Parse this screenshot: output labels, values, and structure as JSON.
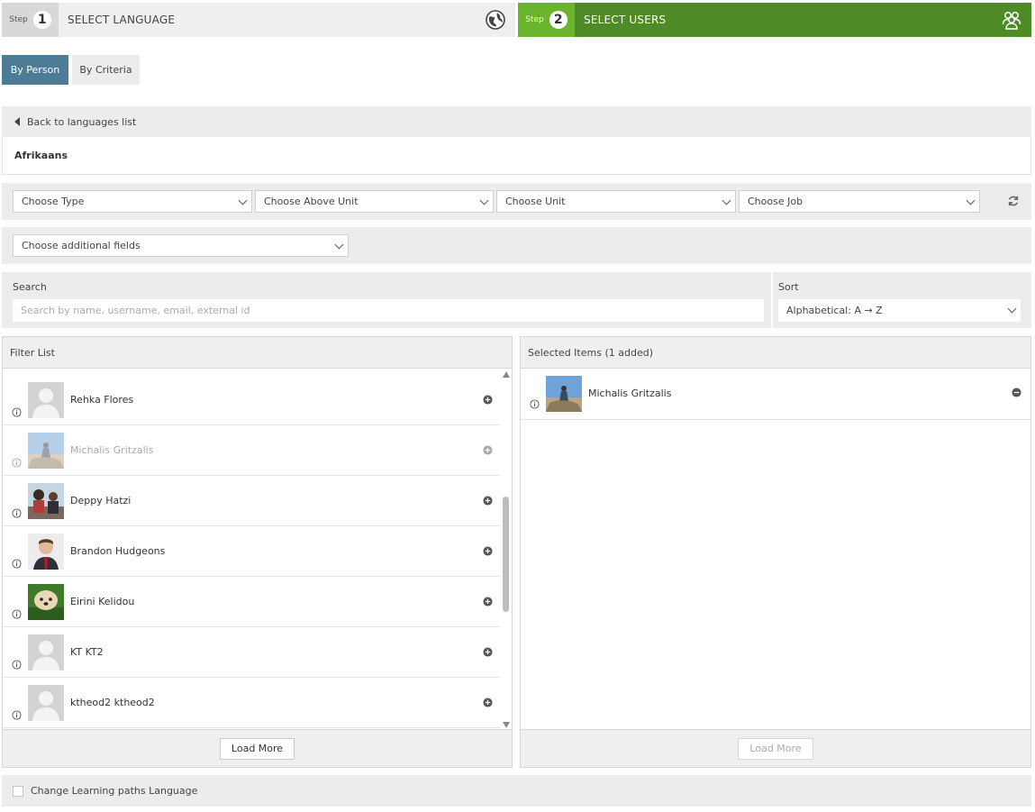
{
  "steps": [
    {
      "word": "Step",
      "number": "1",
      "title": "SELECT LANGUAGE",
      "icon": "globe-icon"
    },
    {
      "word": "Step",
      "number": "2",
      "title": "SELECT USERS",
      "icon": "users-icon"
    }
  ],
  "tabs": [
    {
      "label": "By Person",
      "active": true
    },
    {
      "label": "By Criteria",
      "active": false
    }
  ],
  "back_link": "Back to languages list",
  "language": "Afrikaans",
  "filters": {
    "type": "Choose Type",
    "above_unit": "Choose Above Unit",
    "unit": "Choose Unit",
    "job": "Choose Job",
    "additional": "Choose additional fields"
  },
  "search": {
    "label": "Search",
    "placeholder": "Search by name, username, email, external id"
  },
  "sort": {
    "label": "Sort",
    "value": "Alphabetical: A → Z"
  },
  "filter_list": {
    "title": "Filter List",
    "load_more": "Load More",
    "items": [
      {
        "name": "Rehka Flores",
        "avatar": "placeholder"
      },
      {
        "name": "Michalis Gritzalis",
        "avatar": "photo-sky",
        "disabled": true
      },
      {
        "name": "Deppy Hatzi",
        "avatar": "photo-people"
      },
      {
        "name": "Brandon Hudgeons",
        "avatar": "photo-man"
      },
      {
        "name": "Eirini Kelidou",
        "avatar": "photo-dog"
      },
      {
        "name": "KT KT2",
        "avatar": "placeholder"
      },
      {
        "name": "ktheod2 ktheod2",
        "avatar": "placeholder"
      }
    ]
  },
  "selected": {
    "title": "Selected Items  (1 added)",
    "load_more": "Load More",
    "items": [
      {
        "name": "Michalis Gritzalis",
        "avatar": "photo-sky"
      }
    ]
  },
  "change_paths_label": "Change Learning paths Language",
  "colors": {
    "step_active": "#4e8a25",
    "step_active_num": "#6bb52c",
    "tab_active": "#4c7c96"
  }
}
